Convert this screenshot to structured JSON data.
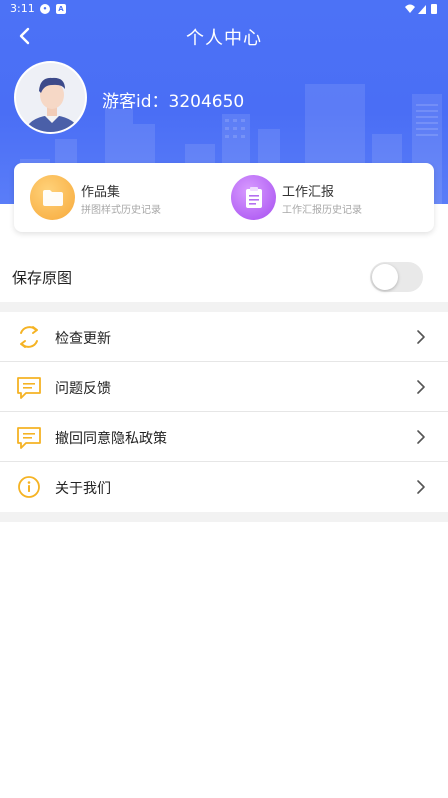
{
  "status_bar": {
    "time": "3:11",
    "icons": [
      "notification-dot-icon",
      "sim-icon",
      "wifi-icon",
      "signal-icon",
      "battery-icon"
    ]
  },
  "nav": {
    "title": "个人中心",
    "back_icon": "chevron-left-icon"
  },
  "profile": {
    "user_id_text": "游客id：3204650"
  },
  "card": {
    "items": [
      {
        "title": "作品集",
        "subtitle": "拼图样式历史记录",
        "icon": "folder-icon",
        "color": "#f7a93a"
      },
      {
        "title": "工作汇报",
        "subtitle": "工作汇报历史记录",
        "icon": "clipboard-icon",
        "color": "#a64ef0"
      }
    ]
  },
  "settings": {
    "save_original_label": "保存原图",
    "save_original_enabled": false
  },
  "menu": {
    "items": [
      {
        "label": "检查更新",
        "icon": "refresh-icon"
      },
      {
        "label": "问题反馈",
        "icon": "message-icon"
      },
      {
        "label": "撤回同意隐私政策",
        "icon": "message-icon"
      },
      {
        "label": "关于我们",
        "icon": "info-icon"
      }
    ]
  },
  "colors": {
    "header_blue": "#4c72f6",
    "accent_orange": "#f7a93a",
    "accent_purple": "#a64ef0",
    "icon_yellow": "#f5b324"
  }
}
